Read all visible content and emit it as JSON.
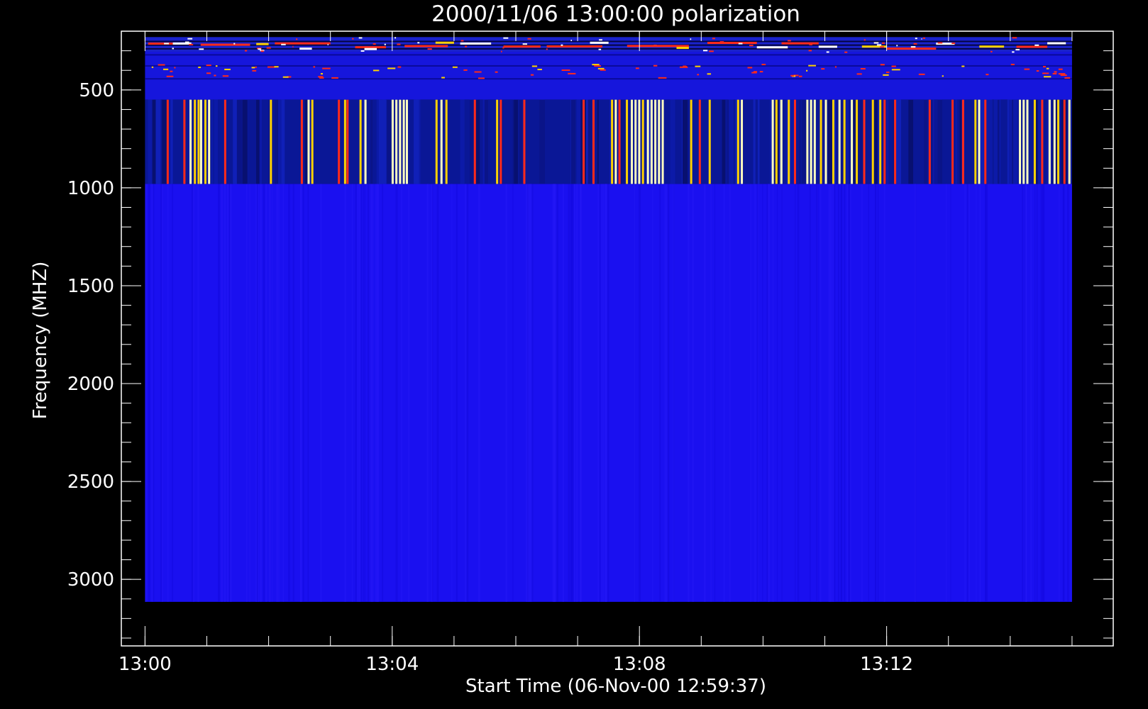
{
  "chart_data": {
    "type": "heatmap",
    "title": "2000/11/06 13:00:00 polarization",
    "xlabel": "Start Time (06-Nov-00 12:59:37)",
    "ylabel": "Frequency (MHZ)",
    "x_range": [
      "12:59:37",
      "13:15:40"
    ],
    "x_ticks": [
      "13:00",
      "13:04",
      "13:08",
      "13:12"
    ],
    "x_minor_every_min": 1,
    "y_range": [
      200,
      3340
    ],
    "y_inverted": true,
    "y_ticks": [
      500,
      1000,
      1500,
      2000,
      2500,
      3000
    ],
    "y_minor_every": 100,
    "data_extent": {
      "t_start": "13:00:00",
      "t_end": "13:15:00",
      "f_low": 230,
      "f_high": 3115
    },
    "bands": [
      {
        "name": "top-band",
        "f_from": 230,
        "f_to": 305,
        "background": "#1a22cc",
        "pattern": "horizontal-streaks"
      },
      {
        "name": "upper-band",
        "f_from": 305,
        "f_to": 550,
        "background": "#1616dc",
        "pattern": "sparse-streaks"
      },
      {
        "name": "burst-band",
        "f_from": 550,
        "f_to": 980,
        "background": "#0a1796",
        "pattern": "vertical-stripes"
      },
      {
        "name": "quiet-band",
        "f_from": 980,
        "f_to": 3115,
        "background": "#1a10f0",
        "pattern": "faint-stripes"
      }
    ],
    "burst_stripes_min": [
      [
        0.35,
        "#ff2a1a"
      ],
      [
        0.62,
        "#ff2a1a"
      ],
      [
        0.72,
        "#ffffc0"
      ],
      [
        0.79,
        "#ffd200"
      ],
      [
        0.85,
        "#ffd200"
      ],
      [
        0.89,
        "#ffffc0"
      ],
      [
        0.96,
        "#ffd200"
      ],
      [
        1.02,
        "#ffffc0"
      ],
      [
        1.28,
        "#ff2a1a"
      ],
      [
        2.02,
        "#ffd200"
      ],
      [
        2.52,
        "#ff2a1a"
      ],
      [
        2.63,
        "#ffffc0"
      ],
      [
        2.69,
        "#ffd200"
      ],
      [
        3.12,
        "#ff2a1a"
      ],
      [
        3.22,
        "#ffd200"
      ],
      [
        3.26,
        "#ff2a1a"
      ],
      [
        3.47,
        "#ffd200"
      ],
      [
        3.55,
        "#ffffc0"
      ],
      [
        3.99,
        "#ffffc0"
      ],
      [
        4.05,
        "#ffffc0"
      ],
      [
        4.11,
        "#ffffc0"
      ],
      [
        4.17,
        "#ffffc0"
      ],
      [
        4.22,
        "#ffffc0"
      ],
      [
        4.7,
        "#ffd200"
      ],
      [
        4.78,
        "#ffffc0"
      ],
      [
        4.86,
        "#ffd200"
      ],
      [
        5.32,
        "#ff2a1a"
      ],
      [
        5.68,
        "#ffd200"
      ],
      [
        5.74,
        "#ff2a1a"
      ],
      [
        6.12,
        "#ff2a1a"
      ],
      [
        7.08,
        "#ff2a1a"
      ],
      [
        7.24,
        "#ff2a1a"
      ],
      [
        7.54,
        "#ffd200"
      ],
      [
        7.6,
        "#ffffc0"
      ],
      [
        7.66,
        "#ff2a1a"
      ],
      [
        7.78,
        "#ffd200"
      ],
      [
        7.86,
        "#ffffc0"
      ],
      [
        7.92,
        "#ffffc0"
      ],
      [
        7.98,
        "#ffffc0"
      ],
      [
        8.04,
        "#ffd200"
      ],
      [
        8.12,
        "#ffffc0"
      ],
      [
        8.18,
        "#ffffc0"
      ],
      [
        8.24,
        "#ffffc0"
      ],
      [
        8.3,
        "#ffffc0"
      ],
      [
        8.36,
        "#ffffc0"
      ],
      [
        8.82,
        "#ffd200"
      ],
      [
        8.96,
        "#ff2a1a"
      ],
      [
        9.12,
        "#ffd200"
      ],
      [
        9.58,
        "#ffd200"
      ],
      [
        9.64,
        "#ffffc0"
      ],
      [
        10.14,
        "#ffffc0"
      ],
      [
        10.2,
        "#ffd200"
      ],
      [
        10.28,
        "#ffffc0"
      ],
      [
        10.4,
        "#ffd200"
      ],
      [
        10.5,
        "#ff2a1a"
      ],
      [
        10.7,
        "#ffffc0"
      ],
      [
        10.76,
        "#ffffc0"
      ],
      [
        10.82,
        "#ffffc0"
      ],
      [
        10.92,
        "#ffd200"
      ],
      [
        11.0,
        "#ffffc0"
      ],
      [
        11.12,
        "#ffd200"
      ],
      [
        11.22,
        "#ffffc0"
      ],
      [
        11.3,
        "#ffd200"
      ],
      [
        11.42,
        "#ffffc0"
      ],
      [
        11.5,
        "#ffd200"
      ],
      [
        11.62,
        "#ff2a1a"
      ],
      [
        11.76,
        "#ffd200"
      ],
      [
        11.88,
        "#ffd200"
      ],
      [
        11.95,
        "#ff2a1a"
      ],
      [
        12.12,
        "#ff2a1a"
      ],
      [
        12.68,
        "#ff2a1a"
      ],
      [
        13.05,
        "#ff2a1a"
      ],
      [
        13.22,
        "#ff2a1a"
      ],
      [
        13.42,
        "#ffd200"
      ],
      [
        13.48,
        "#ffffc0"
      ],
      [
        13.58,
        "#ff2a1a"
      ],
      [
        14.14,
        "#ffffc0"
      ],
      [
        14.2,
        "#ffffc0"
      ],
      [
        14.26,
        "#ffffc0"
      ],
      [
        14.38,
        "#ffd200"
      ],
      [
        14.5,
        "#ff2a1a"
      ],
      [
        14.62,
        "#ffffc0"
      ],
      [
        14.7,
        "#ffffc0"
      ],
      [
        14.76,
        "#ffd200"
      ],
      [
        14.86,
        "#ff2a1a"
      ],
      [
        14.94,
        "#ffffc0"
      ]
    ],
    "top_streaks_min": [
      [
        0.05,
        0.4,
        "#ff2a1a"
      ],
      [
        0.45,
        0.3,
        "#ffffff"
      ],
      [
        0.9,
        0.8,
        "#ff2a1a"
      ],
      [
        1.8,
        0.2,
        "#ffd200"
      ],
      [
        2.1,
        0.9,
        "#ff2a1a"
      ],
      [
        2.5,
        0.2,
        "#ffffff"
      ],
      [
        3.4,
        0.5,
        "#ff2a1a"
      ],
      [
        3.55,
        0.2,
        "#ffffff"
      ],
      [
        4.2,
        0.7,
        "#ff2a1a"
      ],
      [
        4.7,
        0.3,
        "#ffd200"
      ],
      [
        5.1,
        0.5,
        "#ffffff"
      ],
      [
        5.8,
        0.6,
        "#ff2a1a"
      ],
      [
        6.5,
        0.9,
        "#ff2a1a"
      ],
      [
        7.2,
        0.3,
        "#ffffff"
      ],
      [
        7.8,
        1.0,
        "#ff2a1a"
      ],
      [
        8.6,
        0.2,
        "#ffd200"
      ],
      [
        9.1,
        0.8,
        "#ff2a1a"
      ],
      [
        9.9,
        0.5,
        "#ffffff"
      ],
      [
        10.3,
        0.6,
        "#ff2a1a"
      ],
      [
        10.9,
        0.3,
        "#ffffff"
      ],
      [
        11.6,
        0.4,
        "#ffd200"
      ],
      [
        12.0,
        0.8,
        "#ff2a1a"
      ],
      [
        12.8,
        0.3,
        "#ffffff"
      ],
      [
        13.5,
        0.4,
        "#ffd200"
      ],
      [
        14.1,
        0.5,
        "#ff2a1a"
      ],
      [
        14.6,
        0.3,
        "#ffffff"
      ]
    ]
  }
}
